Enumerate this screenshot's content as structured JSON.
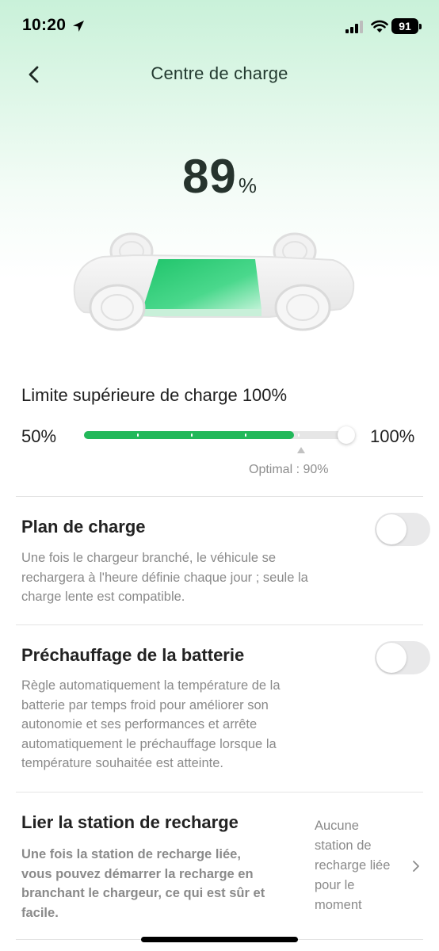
{
  "status_bar": {
    "time": "10:20",
    "battery": "91"
  },
  "header": {
    "title": "Centre de charge"
  },
  "charge": {
    "value": "89",
    "unit": "%",
    "level_fraction": 0.89
  },
  "charge_limit": {
    "label": "Limite supérieure de charge 100%",
    "min_label": "50%",
    "max_label": "100%",
    "current_limit_percent": 100,
    "optimal_label": "Optimal : 90%",
    "optimal_percent": 90
  },
  "charge_plan": {
    "title": "Plan de charge",
    "description_lines": [
      "Une fois le chargeur branché, le véhicule se",
      "rechargera à l'heure définie chaque jour ; seule la",
      "charge lente est compatible."
    ],
    "enabled": false
  },
  "battery_preheat": {
    "title": "Préchauffage de la batterie",
    "description_lines": [
      "Règle automatiquement la température de la",
      "batterie par temps froid pour améliorer son",
      "autonomie et ses performances et arrête",
      "automatiquement le préchauffage lorsque la",
      "température souhaitée est atteinte."
    ],
    "enabled": false
  },
  "link_station": {
    "title": "Lier la station de recharge",
    "description_lines": [
      "Une fois la station de recharge liée,",
      "vous pouvez démarrer la recharge en",
      "branchant le chargeur, ce qui est sûr et",
      "facile."
    ],
    "value_lines": [
      "Aucune",
      "station de",
      "recharge liée",
      "pour le",
      "moment"
    ]
  },
  "colors": {
    "accent": "#22b85a",
    "header_gradient": "#c9f1d9",
    "toggle_off": "#e9e9ea"
  }
}
